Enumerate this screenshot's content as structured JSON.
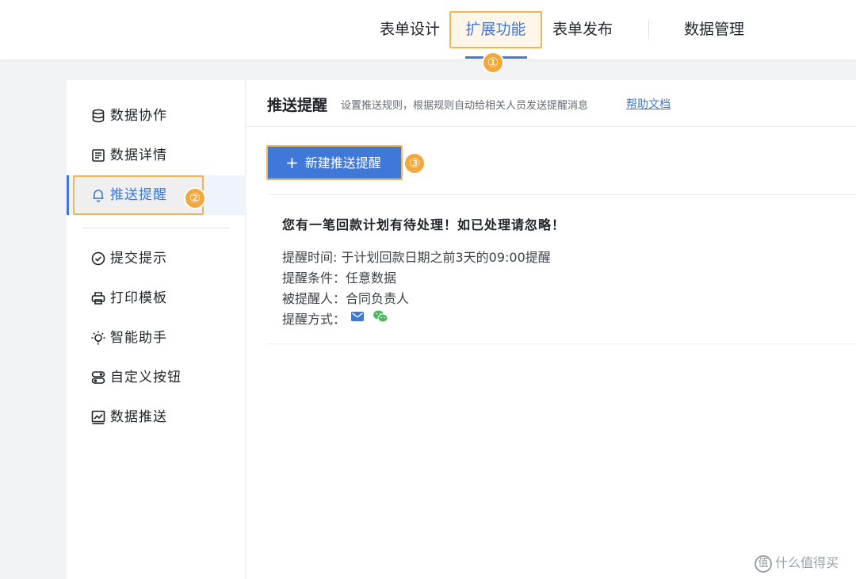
{
  "topnav": {
    "tabs": [
      {
        "label": "表单设计"
      },
      {
        "label": "扩展功能"
      },
      {
        "label": "表单发布"
      },
      {
        "label": "数据管理"
      }
    ],
    "active_tab": "扩展功能"
  },
  "markers": {
    "m1": "①",
    "m2": "②",
    "m3": "③"
  },
  "sidebar": {
    "items": [
      {
        "label": "数据协作",
        "icon": "database-icon"
      },
      {
        "label": "数据详情",
        "icon": "detail-icon"
      },
      {
        "label": "推送提醒",
        "icon": "bell-icon"
      },
      {
        "label": "提交提示",
        "icon": "check-circle-icon"
      },
      {
        "label": "打印模板",
        "icon": "printer-icon"
      },
      {
        "label": "智能助手",
        "icon": "lightbulb-icon"
      },
      {
        "label": "自定义按钮",
        "icon": "button-icon"
      },
      {
        "label": "数据推送",
        "icon": "chart-icon"
      }
    ],
    "active_item": "推送提醒"
  },
  "main": {
    "title": "推送提醒",
    "description": "设置推送规则，根据规则自动给相关人员发送提醒消息",
    "help_link": "帮助文档",
    "new_button_label": "新建推送提醒",
    "card": {
      "title": "您有一笔回款计划有待处理！如已处理请忽略！",
      "time_line": "提醒时间: 于计划回款日期之前3天的09:00提醒",
      "condition_line": "提醒条件：任意数据",
      "recipient_line": "被提醒人：合同负责人",
      "method_label": "提醒方式："
    }
  },
  "watermark": {
    "text": "什么值得买",
    "logo": "值"
  },
  "colors": {
    "accent": "#3f78d8",
    "highlight_border": "#f2b555",
    "marker": "#f2a83b",
    "wechat": "#4cb85c"
  }
}
